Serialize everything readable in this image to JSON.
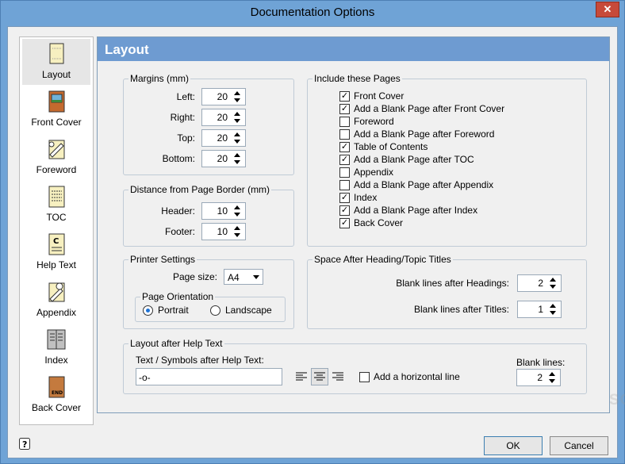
{
  "window": {
    "title": "Documentation Options",
    "close": "✕"
  },
  "sidebar": {
    "items": [
      {
        "label": "Layout",
        "icon": "page-icon"
      },
      {
        "label": "Front Cover",
        "icon": "front-cover-icon"
      },
      {
        "label": "Foreword",
        "icon": "foreword-icon"
      },
      {
        "label": "TOC",
        "icon": "toc-icon"
      },
      {
        "label": "Help Text",
        "icon": "help-text-icon"
      },
      {
        "label": "Appendix",
        "icon": "appendix-icon"
      },
      {
        "label": "Index",
        "icon": "index-icon"
      },
      {
        "label": "Back Cover",
        "icon": "back-cover-icon"
      }
    ]
  },
  "panel": {
    "title": "Layout"
  },
  "margins": {
    "title": "Margins (mm)",
    "left_label": "Left:",
    "left": "20",
    "right_label": "Right:",
    "right": "20",
    "top_label": "Top:",
    "top": "20",
    "bottom_label": "Bottom:",
    "bottom": "20"
  },
  "distance": {
    "title": "Distance from Page Border (mm)",
    "header_label": "Header:",
    "header": "10",
    "footer_label": "Footer:",
    "footer": "10"
  },
  "include": {
    "title": "Include these Pages",
    "items": [
      {
        "label": "Front Cover",
        "checked": true
      },
      {
        "label": "Add a Blank Page after Front Cover",
        "checked": true
      },
      {
        "label": "Foreword",
        "checked": false
      },
      {
        "label": "Add a Blank Page after Foreword",
        "checked": false
      },
      {
        "label": "Table of Contents",
        "checked": true
      },
      {
        "label": "Add a Blank Page after TOC",
        "checked": true
      },
      {
        "label": "Appendix",
        "checked": false
      },
      {
        "label": "Add a Blank Page after Appendix",
        "checked": false
      },
      {
        "label": "Index",
        "checked": true
      },
      {
        "label": "Add a Blank Page after Index",
        "checked": true
      },
      {
        "label": "Back Cover",
        "checked": true
      }
    ]
  },
  "printer": {
    "title": "Printer Settings",
    "page_size_label": "Page size:",
    "page_size": "A4",
    "orientation_title": "Page Orientation",
    "portrait": "Portrait",
    "landscape": "Landscape",
    "selected": "Portrait"
  },
  "spacing": {
    "title": "Space After Heading/Topic Titles",
    "headings_label": "Blank lines after Headings:",
    "headings": "2",
    "titles_label": "Blank lines after Titles:",
    "titles": "1"
  },
  "after_help": {
    "title": "Layout after Help Text",
    "symbols_label": "Text / Symbols after Help Text:",
    "symbols_value": "-o-",
    "hline_label": "Add a horizontal line",
    "hline_checked": false,
    "blank_lines_label": "Blank lines:",
    "blank_lines": "2",
    "alignment": "center"
  },
  "buttons": {
    "ok": "OK",
    "cancel": "Cancel",
    "help": "?"
  },
  "watermark": "SOFTPEDIA"
}
